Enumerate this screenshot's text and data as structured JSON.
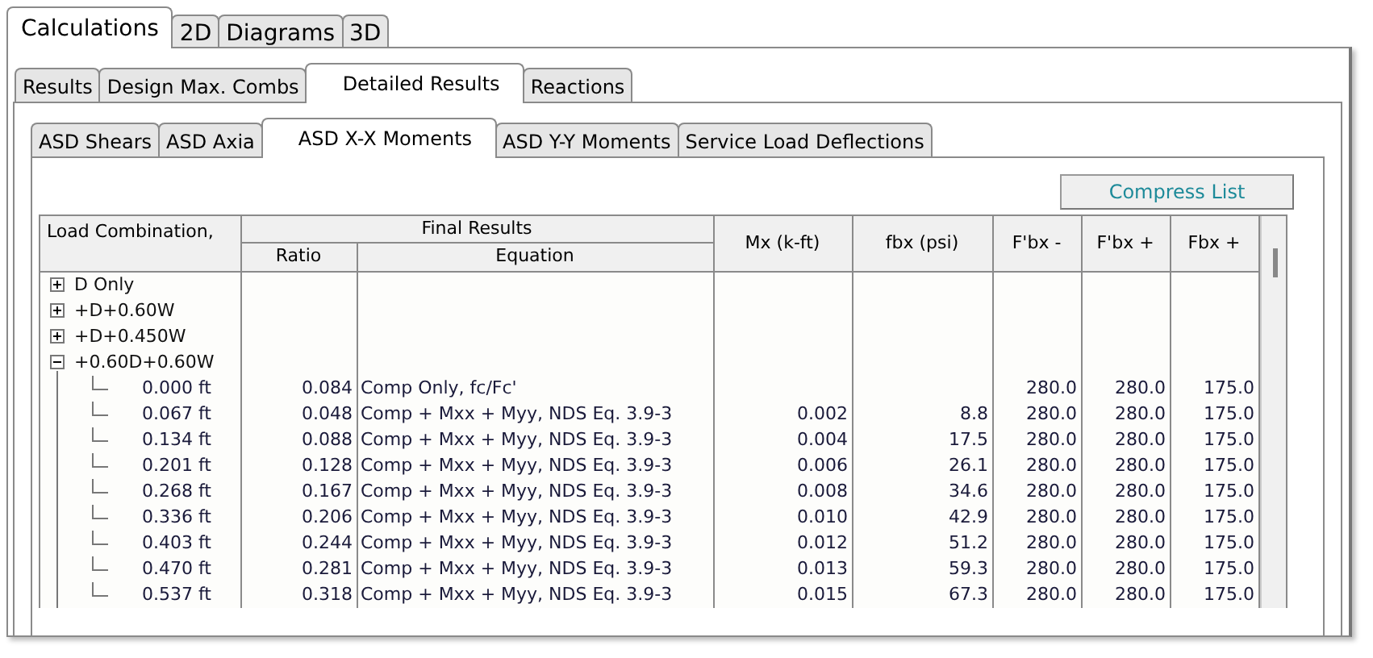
{
  "main_tabs": [
    {
      "label": "Calculations",
      "selected": true
    },
    {
      "label": "2D",
      "selected": false
    },
    {
      "label": "Diagrams",
      "selected": false
    },
    {
      "label": "3D",
      "selected": false
    }
  ],
  "result_tabs": [
    {
      "label": "Results",
      "selected": false
    },
    {
      "label": "Design Max. Combs",
      "selected": false
    },
    {
      "label": "Detailed Results",
      "selected": true
    },
    {
      "label": "Reactions",
      "selected": false
    }
  ],
  "detail_tabs": [
    {
      "label": "ASD Shears",
      "selected": false
    },
    {
      "label": "ASD Axia",
      "selected": false
    },
    {
      "label": "ASD X-X Moments",
      "selected": true
    },
    {
      "label": "ASD Y-Y Moments",
      "selected": false
    },
    {
      "label": "Service Load Deflections",
      "selected": false
    }
  ],
  "compress_button": "Compress List",
  "table": {
    "first_column": "Load Combination,",
    "group_header": "Final Results",
    "columns": [
      "Ratio",
      "Equation",
      "Mx (k-ft)",
      "fbx (psi)",
      "F'bx -",
      "F'bx +",
      "Fbx +"
    ],
    "groups": [
      {
        "label": "D Only",
        "expanded": false
      },
      {
        "label": "+D+0.60W",
        "expanded": false
      },
      {
        "label": "+D+0.450W",
        "expanded": false
      },
      {
        "label": "+0.60D+0.60W",
        "expanded": true,
        "children": [
          {
            "location": "0.000 ft",
            "values": {
              "ratio": "0.084",
              "equation": "Comp Only, fc/Fc'",
              "f_bx_minus": "280.0",
              "f_bx_plus": "280.0",
              "fbx_plus": "175.0"
            }
          },
          {
            "location": "0.067 ft",
            "values": {
              "ratio": "0.048",
              "equation": "Comp + Mxx + Myy, NDS Eq. 3.9-3",
              "mx": "0.002",
              "fbx": "8.8",
              "f_bx_minus": "280.0",
              "f_bx_plus": "280.0",
              "fbx_plus": "175.0"
            }
          },
          {
            "location": "0.134 ft",
            "values": {
              "ratio": "0.088",
              "equation": "Comp + Mxx + Myy, NDS Eq. 3.9-3",
              "mx": "0.004",
              "fbx": "17.5",
              "f_bx_minus": "280.0",
              "f_bx_plus": "280.0",
              "fbx_plus": "175.0"
            }
          },
          {
            "location": "0.201 ft",
            "values": {
              "ratio": "0.128",
              "equation": "Comp + Mxx + Myy, NDS Eq. 3.9-3",
              "mx": "0.006",
              "fbx": "26.1",
              "f_bx_minus": "280.0",
              "f_bx_plus": "280.0",
              "fbx_plus": "175.0"
            }
          },
          {
            "location": "0.268 ft",
            "values": {
              "ratio": "0.167",
              "equation": "Comp + Mxx + Myy, NDS Eq. 3.9-3",
              "mx": "0.008",
              "fbx": "34.6",
              "f_bx_minus": "280.0",
              "f_bx_plus": "280.0",
              "fbx_plus": "175.0"
            }
          },
          {
            "location": "0.336 ft",
            "values": {
              "ratio": "0.206",
              "equation": "Comp + Mxx + Myy, NDS Eq. 3.9-3",
              "mx": "0.010",
              "fbx": "42.9",
              "f_bx_minus": "280.0",
              "f_bx_plus": "280.0",
              "fbx_plus": "175.0"
            }
          },
          {
            "location": "0.403 ft",
            "values": {
              "ratio": "0.244",
              "equation": "Comp + Mxx + Myy, NDS Eq. 3.9-3",
              "mx": "0.012",
              "fbx": "51.2",
              "f_bx_minus": "280.0",
              "f_bx_plus": "280.0",
              "fbx_plus": "175.0"
            }
          },
          {
            "location": "0.470 ft",
            "values": {
              "ratio": "0.281",
              "equation": "Comp + Mxx + Myy, NDS Eq. 3.9-3",
              "mx": "0.013",
              "fbx": "59.3",
              "f_bx_minus": "280.0",
              "f_bx_plus": "280.0",
              "fbx_plus": "175.0"
            }
          },
          {
            "location": "0.537 ft",
            "values": {
              "ratio": "0.318",
              "equation": "Comp + Mxx + Myy, NDS Eq. 3.9-3",
              "mx": "0.015",
              "fbx": "67.3",
              "f_bx_minus": "280.0",
              "f_bx_plus": "280.0",
              "fbx_plus": "175.0"
            }
          }
        ]
      }
    ]
  }
}
